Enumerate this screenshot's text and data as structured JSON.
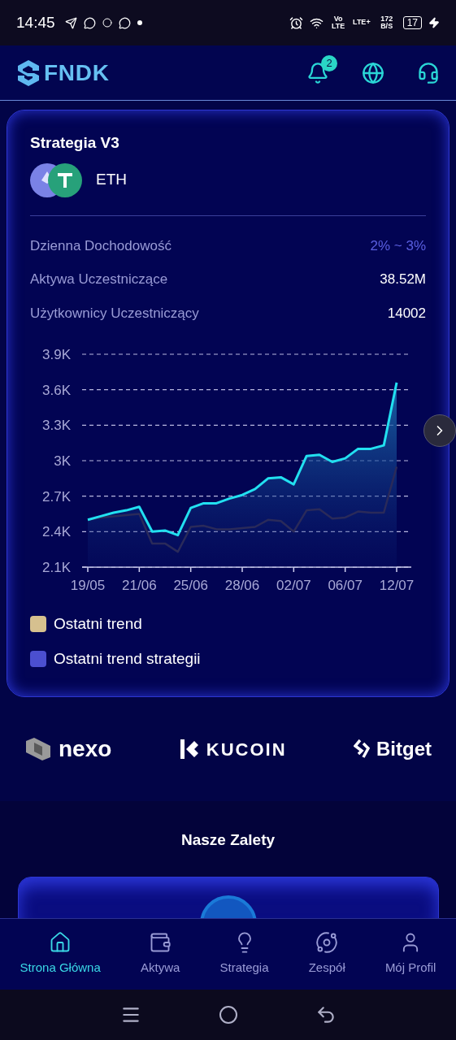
{
  "status_bar": {
    "time": "14:45",
    "volte": "Vo LTE",
    "network": "LTE+",
    "speed": "172 B/S",
    "battery": "17"
  },
  "header": {
    "brand": "FNDK",
    "notification_count": "2"
  },
  "strategy_card": {
    "title": "Strategia V3",
    "asset": "ETH",
    "stats": [
      {
        "label": "Dzienna Dochodowość",
        "value": "2% ~ 3%",
        "kind": "accent"
      },
      {
        "label": "Aktywa Uczestniczące",
        "value": "38.52M",
        "kind": "plain"
      },
      {
        "label": "Użytkownicy Uczestniczący",
        "value": "14002",
        "kind": "plain"
      }
    ],
    "chart_data": {
      "type": "line",
      "categories": [
        "19/05",
        null,
        null,
        null,
        "21/06",
        null,
        null,
        null,
        "25/06",
        null,
        null,
        null,
        "28/06",
        null,
        null,
        null,
        "02/07",
        null,
        null,
        null,
        "06/07",
        null,
        null,
        null,
        "12/07"
      ],
      "yticks": [
        {
          "value": 2100,
          "label": "2.1K"
        },
        {
          "value": 2400,
          "label": "2.4K"
        },
        {
          "value": 2700,
          "label": "2.7K"
        },
        {
          "value": 3000,
          "label": "3K"
        },
        {
          "value": 3300,
          "label": "3.3K"
        },
        {
          "value": 3600,
          "label": "3.6K"
        },
        {
          "value": 3900,
          "label": "3.9K"
        }
      ],
      "ylim": [
        2100,
        3900
      ],
      "grid": true,
      "series": [
        {
          "name": "Ostatni trend",
          "color": "#2a2a5a",
          "type": "line",
          "values": [
            2500,
            2520,
            2530,
            2540,
            2550,
            2300,
            2300,
            2230,
            2440,
            2450,
            2420,
            2420,
            2430,
            2440,
            2500,
            2490,
            2400,
            2580,
            2590,
            2510,
            2520,
            2570,
            2560,
            2560,
            2950
          ]
        },
        {
          "name": "Ostatni trend strategii",
          "color": "#22e0f0",
          "type": "area",
          "values": [
            2500,
            2530,
            2560,
            2580,
            2610,
            2400,
            2410,
            2370,
            2600,
            2640,
            2640,
            2680,
            2710,
            2760,
            2850,
            2860,
            2800,
            3040,
            3050,
            2990,
            3020,
            3100,
            3100,
            3130,
            3660
          ]
        }
      ]
    },
    "legend_swatches": [
      {
        "color": "#d6c08f"
      },
      {
        "color": "#4b4fd0"
      }
    ]
  },
  "partners": [
    "nexo",
    "KUCOIN",
    "Bitget"
  ],
  "advantages": {
    "title": "Nasze Zalety"
  },
  "bottom_nav": [
    {
      "label": "Strona Główna",
      "selected": true,
      "kind": "home"
    },
    {
      "label": "Aktywa",
      "selected": false,
      "kind": "wallet"
    },
    {
      "label": "Strategia",
      "selected": false,
      "kind": "bulb"
    },
    {
      "label": "Zespół",
      "selected": false,
      "kind": "planet"
    },
    {
      "label": "Mój Profil",
      "selected": false,
      "kind": "user"
    }
  ]
}
